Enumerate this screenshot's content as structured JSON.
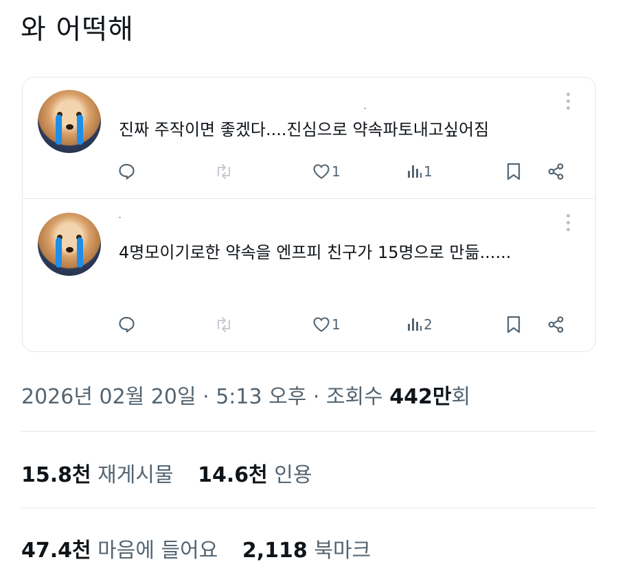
{
  "post": {
    "text": "와 어떡해"
  },
  "quote_card": {
    "replies": [
      {
        "text": "진짜 주작이면 좋겠다....진심으로 약속파토내고싶어짐",
        "likes": "1",
        "views": "1"
      },
      {
        "text": "4명모이기로한 약속을 엔프피 친구가 15명으로 만듦......",
        "likes": "1",
        "views": "2"
      }
    ]
  },
  "meta": {
    "date": "2026년 02월 20일",
    "sep1": " · ",
    "time": "5:13 오후",
    "sep2": " · ",
    "views_label": "조회수 ",
    "views_value": "442만",
    "views_unit": "회"
  },
  "stats": {
    "reposts": {
      "value": "15.8천",
      "label": "재게시물"
    },
    "quotes": {
      "value": "14.6천",
      "label": "인용"
    },
    "likes": {
      "value": "47.4천",
      "label": "마음에 들어요"
    },
    "bookmarks": {
      "value": "2,118",
      "label": "북마크"
    }
  },
  "colors": {
    "text": "#0f1419",
    "muted": "#536471",
    "border": "#e1e8ed",
    "tear": "#1e8ee8"
  }
}
